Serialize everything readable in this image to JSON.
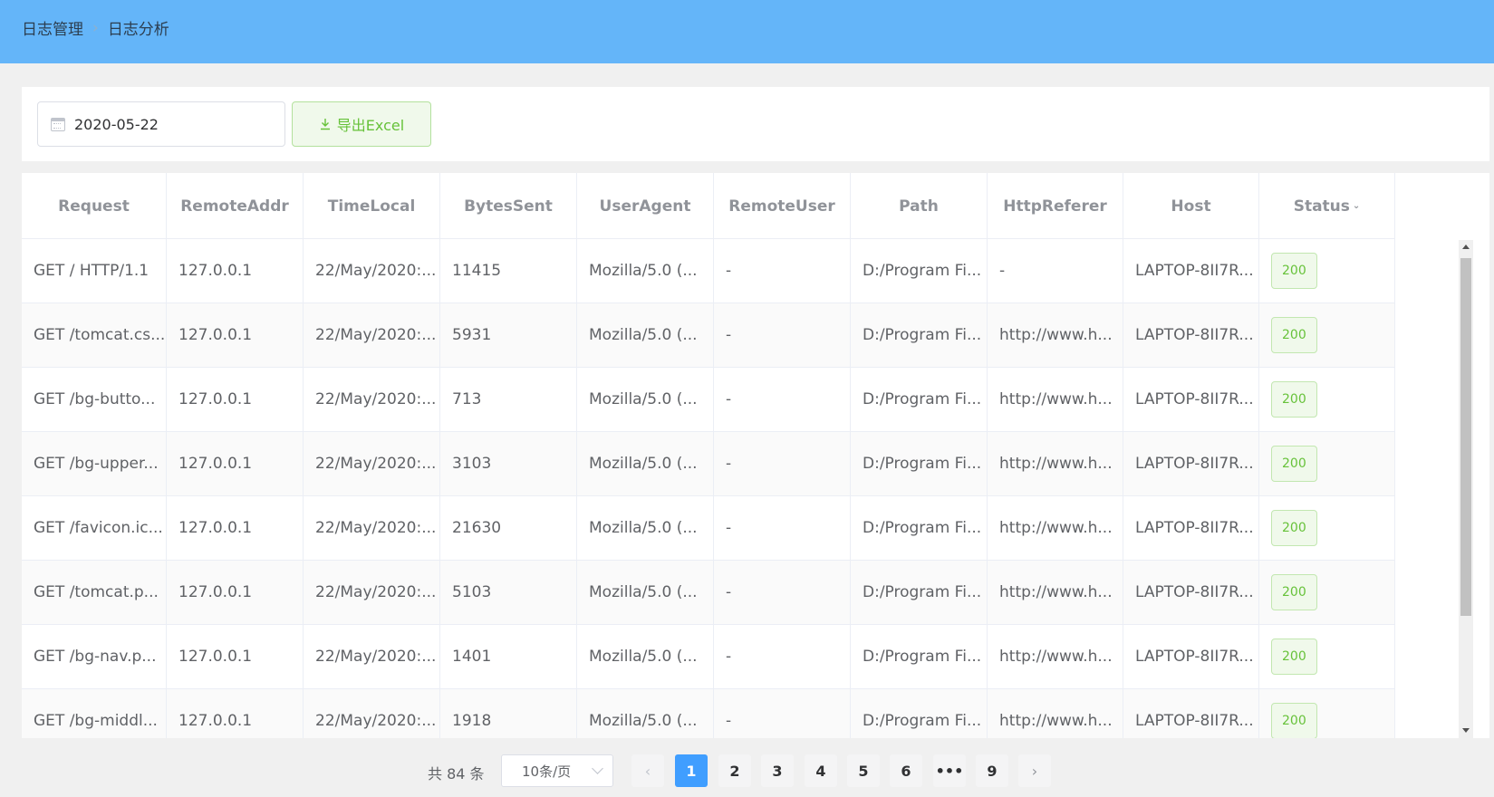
{
  "breadcrumb": {
    "root": "日志管理",
    "separator": "›",
    "current": "日志分析"
  },
  "toolbar": {
    "date_value": "2020-05-22",
    "export_label": "导出Excel",
    "export_icon": "download-icon"
  },
  "table": {
    "columns": [
      "Request",
      "RemoteAddr",
      "TimeLocal",
      "BytesSent",
      "UserAgent",
      "RemoteUser",
      "Path",
      "HttpReferer",
      "Host",
      "Status"
    ],
    "status_sort_indicator": "⌄",
    "rows": [
      [
        "GET / HTTP/1.1",
        "127.0.0.1",
        "22/May/2020:...",
        "11415",
        "Mozilla/5.0 (...",
        "-",
        "D:/Program Fi...",
        "-",
        "LAPTOP-8II7R...",
        "200"
      ],
      [
        "GET /tomcat.cs...",
        "127.0.0.1",
        "22/May/2020:...",
        "5931",
        "Mozilla/5.0 (...",
        "-",
        "D:/Program Fi...",
        "http://www.h...",
        "LAPTOP-8II7R...",
        "200"
      ],
      [
        "GET /bg-butto...",
        "127.0.0.1",
        "22/May/2020:...",
        "713",
        "Mozilla/5.0 (...",
        "-",
        "D:/Program Fi...",
        "http://www.h...",
        "LAPTOP-8II7R...",
        "200"
      ],
      [
        "GET /bg-upper...",
        "127.0.0.1",
        "22/May/2020:...",
        "3103",
        "Mozilla/5.0 (...",
        "-",
        "D:/Program Fi...",
        "http://www.h...",
        "LAPTOP-8II7R...",
        "200"
      ],
      [
        "GET /favicon.ic...",
        "127.0.0.1",
        "22/May/2020:...",
        "21630",
        "Mozilla/5.0 (...",
        "-",
        "D:/Program Fi...",
        "http://www.h...",
        "LAPTOP-8II7R...",
        "200"
      ],
      [
        "GET /tomcat.p...",
        "127.0.0.1",
        "22/May/2020:...",
        "5103",
        "Mozilla/5.0 (...",
        "-",
        "D:/Program Fi...",
        "http://www.h...",
        "LAPTOP-8II7R...",
        "200"
      ],
      [
        "GET /bg-nav.p...",
        "127.0.0.1",
        "22/May/2020:...",
        "1401",
        "Mozilla/5.0 (...",
        "-",
        "D:/Program Fi...",
        "http://www.h...",
        "LAPTOP-8II7R...",
        "200"
      ],
      [
        "GET /bg-middl...",
        "127.0.0.1",
        "22/May/2020:...",
        "1918",
        "Mozilla/5.0 (...",
        "-",
        "D:/Program Fi...",
        "http://www.h...",
        "LAPTOP-8II7R...",
        "200"
      ]
    ]
  },
  "pagination": {
    "total_label": "共 84 条",
    "page_size": "10条/页",
    "prev": "‹",
    "next": "›",
    "pages": [
      "1",
      "2",
      "3",
      "4",
      "5",
      "6",
      "•••",
      "9"
    ],
    "current_page": "1"
  },
  "colors": {
    "header_bar": "#64b5f9",
    "primary": "#409eff",
    "success": "#67c23a"
  }
}
